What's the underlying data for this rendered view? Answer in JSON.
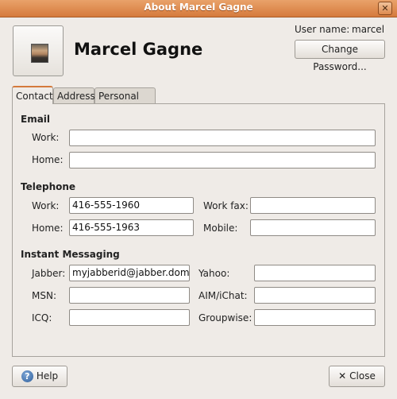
{
  "window": {
    "title": "About Marcel Gagne",
    "close_glyph": "✕"
  },
  "header": {
    "full_name": "Marcel Gagne",
    "username_label": "User name:",
    "username_value": "marcel",
    "change_password_label": "Change Password..."
  },
  "tabs": [
    {
      "label": "Contact",
      "active": true
    },
    {
      "label": "Address",
      "active": false
    },
    {
      "label": "Personal Info",
      "active": false
    }
  ],
  "email": {
    "heading": "Email",
    "work_label": "Work:",
    "work_value": "",
    "home_label": "Home:",
    "home_value": ""
  },
  "telephone": {
    "heading": "Telephone",
    "work_label": "Work:",
    "work_value": "416-555-1960",
    "home_label": "Home:",
    "home_value": "416-555-1963",
    "work_fax_label": "Work fax:",
    "work_fax_value": "",
    "mobile_label": "Mobile:",
    "mobile_value": ""
  },
  "im": {
    "heading": "Instant Messaging",
    "jabber_label": "Jabber:",
    "jabber_value": "myjabberid@jabber.dom",
    "msn_label": "MSN:",
    "msn_value": "",
    "icq_label": "ICQ:",
    "icq_value": "",
    "yahoo_label": "Yahoo:",
    "yahoo_value": "",
    "aim_label": "AIM/iChat:",
    "aim_value": "",
    "groupwise_label": "Groupwise:",
    "groupwise_value": ""
  },
  "footer": {
    "help_label": "Help",
    "help_icon": "?",
    "close_label": "Close",
    "close_icon": "✕"
  },
  "colors": {
    "titlebar": "#d57a3c",
    "active_tab_accent": "#d47a3c"
  }
}
